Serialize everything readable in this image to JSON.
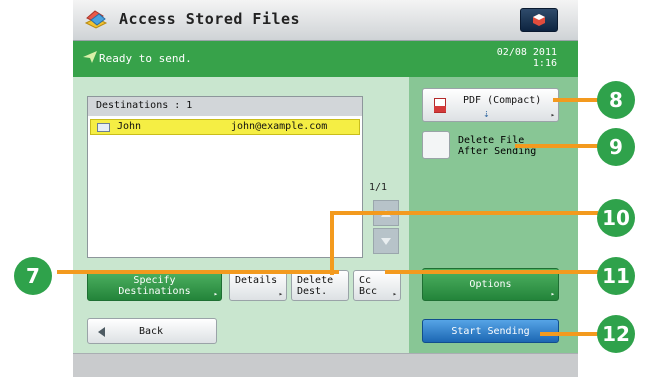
{
  "window": {
    "title": "Access Stored Files"
  },
  "status": {
    "text": "Ready to send.",
    "date": "02/08 2011",
    "time": "1:16"
  },
  "destinations": {
    "header": "Destinations  : 1",
    "rows": [
      {
        "name": "John",
        "email": "john@example.com"
      }
    ],
    "page_indicator": "1/1"
  },
  "buttons": {
    "specify_line1": "Specify",
    "specify_line2": "Destinations",
    "details": "Details",
    "delete_line1": "Delete",
    "delete_line2": "Dest.",
    "cc_line1": "Cc",
    "cc_line2": "Bcc",
    "back": "Back",
    "pdf": "PDF (Compact)",
    "delete_file_line1": "Delete File",
    "delete_file_line2": "After Sending",
    "options": "Options",
    "start": "Start Sending"
  },
  "callouts": [
    "7",
    "8",
    "9",
    "10",
    "11",
    "12"
  ],
  "icons": [
    "app-icon",
    "menu-icon",
    "send-icon",
    "contact-card-icon",
    "pdf-file-icon",
    "download-arrow-icon",
    "scroll-up-icon",
    "scroll-down-icon",
    "back-arrow-icon"
  ],
  "colors": {
    "status_green": "#37a24a",
    "highlight_yellow": "#f5ee44",
    "callout_green": "#2fa24b",
    "callout_line_orange": "#f39a1e",
    "start_blue": "#1c67b3"
  }
}
